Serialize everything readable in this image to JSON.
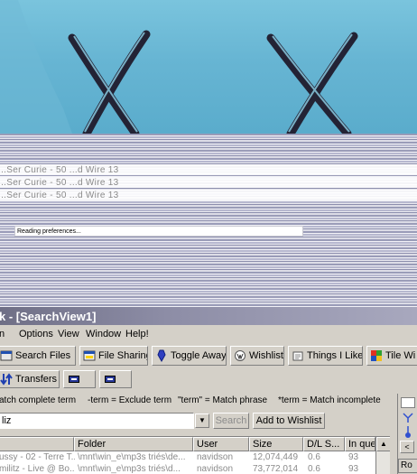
{
  "splash": {
    "ghost_lines": [
      "...Ser Curie - 50 ...d Wire 13",
      "...Ser Curie - 50 ...d Wire 13",
      "...Ser Curie - 50 ...d Wire 13"
    ],
    "loading_text": "Reading preferences..."
  },
  "window": {
    "title": "k - [SearchView1]"
  },
  "menu": {
    "items": [
      "n",
      "Options",
      "View",
      "Window",
      "Help!"
    ]
  },
  "toolbar": {
    "buttons": [
      {
        "label": "Search Files",
        "icon": "search-files-icon"
      },
      {
        "label": "File Sharing",
        "icon": "file-sharing-icon"
      },
      {
        "label": "Toggle Away",
        "icon": "toggle-away-icon"
      },
      {
        "label": "Wishlist",
        "icon": "wishlist-icon"
      },
      {
        "label": "Things I Like",
        "icon": "things-i-like-icon"
      },
      {
        "label": "Tile Wi",
        "icon": "tile-windows-icon"
      }
    ]
  },
  "toolbar2": {
    "transfers_label": "Transfers"
  },
  "hints": {
    "h1": "atch complete term",
    "h2": "-term = Exclude term",
    "h3": "\"term\" = Match phrase",
    "h4": "*term = Match incomplete"
  },
  "search": {
    "value": "liz",
    "search_label": "Search",
    "wishlist_label": "Add to Wishlist"
  },
  "results": {
    "columns": [
      "",
      "Folder",
      "User",
      "Size",
      "D/L S...",
      "In queu"
    ],
    "rows": [
      [
        "ussy - 02 - Terre T...",
        "\\mnt\\win_e\\mp3s triés\\de...",
        "navidson",
        "12,074,449",
        "0.6",
        "93"
      ],
      [
        "militz - Live @ Bo...",
        "\\mnt\\win_e\\mp3s triés\\d...",
        "navidson",
        "73,772,014",
        "0.6",
        "93"
      ]
    ]
  },
  "right_panel": {
    "label": "Ro"
  }
}
